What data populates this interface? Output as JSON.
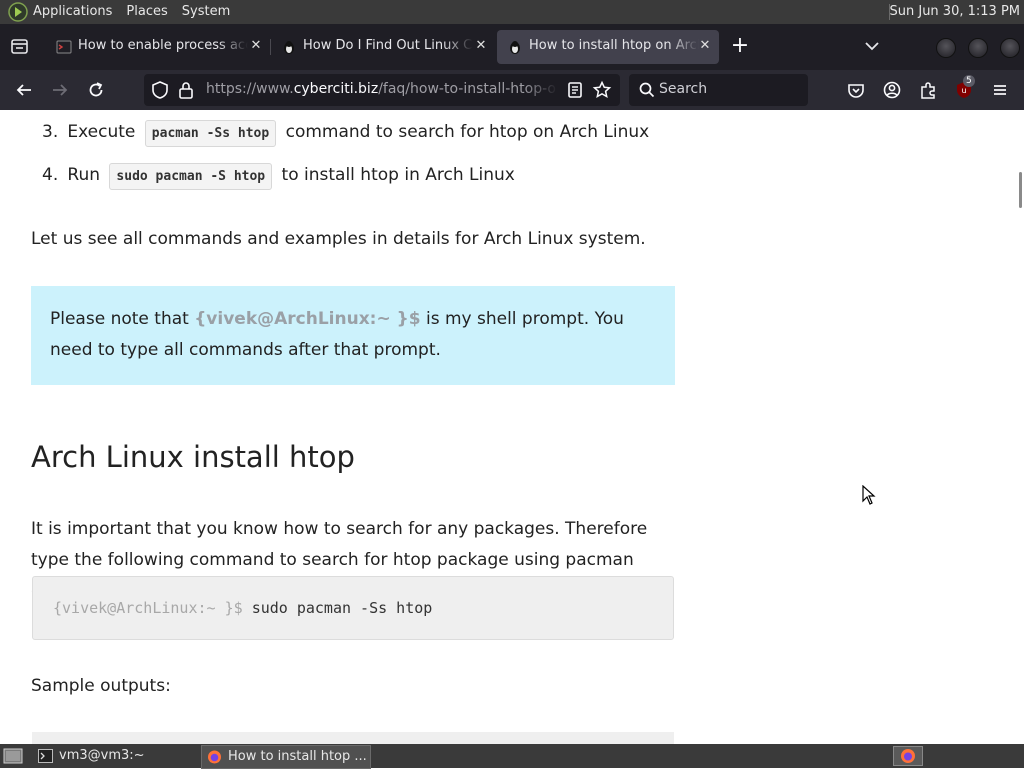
{
  "panel": {
    "menus": [
      "Applications",
      "Places",
      "System"
    ],
    "clock": "Sun Jun 30,  1:13 PM"
  },
  "tabs": [
    {
      "title": "How to enable process acco",
      "active": false
    },
    {
      "title": "How Do I Find Out Linux CPU",
      "active": false
    },
    {
      "title": "How to install htop on Arch L",
      "active": true
    }
  ],
  "toolbar": {
    "url_prefix": "https://www.",
    "url_host": "cyberciti.biz",
    "url_path": "/faq/how-to-install-htop-on-arch",
    "search_placeholder": "Search",
    "extension_badge": "5"
  },
  "article": {
    "steps": [
      {
        "num": "3.",
        "before": "Execute",
        "code": "pacman -Ss htop",
        "after": "command to search for htop on Arch Linux"
      },
      {
        "num": "4.",
        "before": "Run",
        "code": "sudo pacman -S htop",
        "after": "to install htop in Arch Linux"
      }
    ],
    "intro": "Let us see all commands and examples in details for Arch Linux system.",
    "note": {
      "before": "Please note that ",
      "prompt": "{vivek@ArchLinux:~ }$",
      "after": " is my shell prompt. You need to type all commands after that prompt."
    },
    "heading": "Arch Linux install htop",
    "search_para": "It is important that you know how to search for any packages. Therefore type the following command to search for htop package using pacman command:",
    "code_prompt": "{vivek@ArchLinux:~ }$",
    "code_command": "sudo pacman -Ss htop",
    "sample_outputs": "Sample outputs:"
  },
  "taskbar": {
    "items": [
      {
        "label": "vm3@vm3:~",
        "active": false
      },
      {
        "label": "How to install htop ...",
        "active": true
      }
    ]
  },
  "colors": {
    "panel_bg": "#3a3a3a",
    "tabstrip_bg": "#1f1e25",
    "toolbar_bg": "#2b2a33",
    "note_bg": "#ccf2fc",
    "code_bg": "#efefef"
  }
}
